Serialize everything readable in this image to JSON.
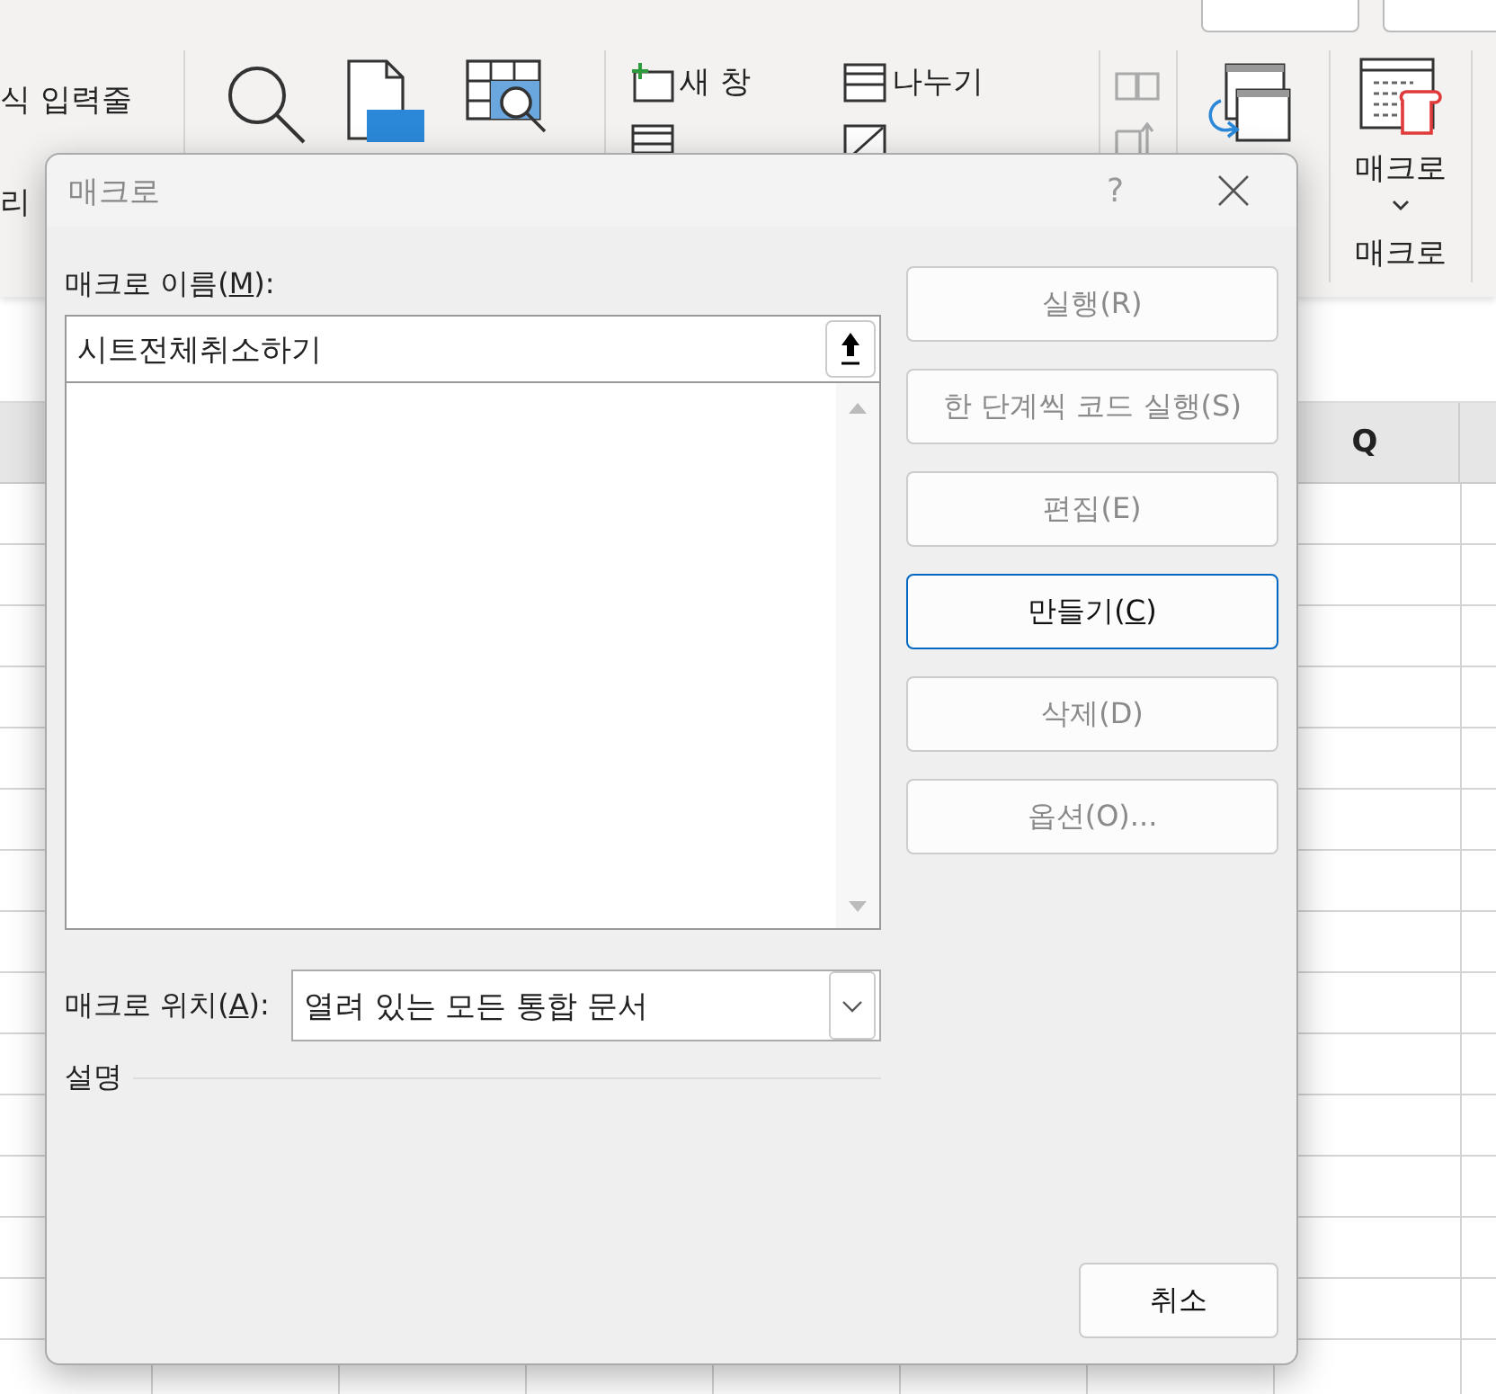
{
  "ribbon": {
    "formula_bar_label": "식 입력줄",
    "header_footer_label": "리",
    "window_group": [
      {
        "kind": "new-window",
        "label": "새 창"
      },
      {
        "kind": "split",
        "label": "나누기"
      },
      {
        "kind": "arrange"
      },
      {
        "kind": "hide"
      }
    ],
    "macro_button": {
      "label": "매크로"
    },
    "macro_group_label": "매크로"
  },
  "column_header": "Q",
  "dialog": {
    "title": "매크로",
    "help": "?",
    "name_label": {
      "prefix": "매크로 이름(",
      "mnemonic": "M",
      "suffix": "):"
    },
    "macro_name": "시트전체취소하기",
    "buttons": [
      {
        "label": "실행(R)",
        "disabled": true,
        "focused": false
      },
      {
        "label": "한 단계씩 코드 실행(S)",
        "disabled": true,
        "focused": false
      },
      {
        "label": "편집(E)",
        "disabled": true,
        "focused": false
      },
      {
        "prefix": "만들기(",
        "mnemonic": "C",
        "suffix": ")",
        "disabled": false,
        "focused": true
      },
      {
        "label": "삭제(D)",
        "disabled": true,
        "focused": false
      },
      {
        "label": "옵션(O)...",
        "disabled": true,
        "focused": false
      }
    ],
    "location_label": {
      "prefix": "매크로 위치(",
      "mnemonic": "A",
      "suffix": "):"
    },
    "location_value": "열려 있는 모든 통합 문서",
    "description_label": "설명",
    "cancel": "취소"
  }
}
